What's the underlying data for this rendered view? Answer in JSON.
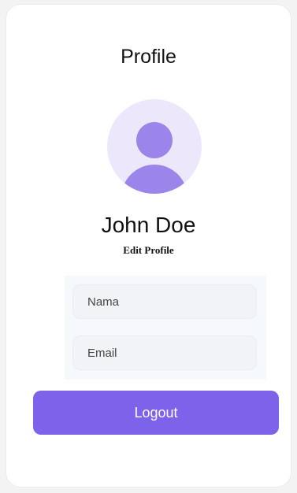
{
  "header": {
    "title": "Profile"
  },
  "profile": {
    "name": "John Doe",
    "edit_label": "Edit Profile",
    "avatar_icon": "user-avatar-icon"
  },
  "form": {
    "name_field": {
      "placeholder": "Nama"
    },
    "email_field": {
      "placeholder": "Email"
    }
  },
  "actions": {
    "logout_label": "Logout"
  },
  "colors": {
    "accent": "#7c63ea",
    "avatar_bg": "#ede7fb",
    "avatar_fg": "#9b85ea"
  }
}
